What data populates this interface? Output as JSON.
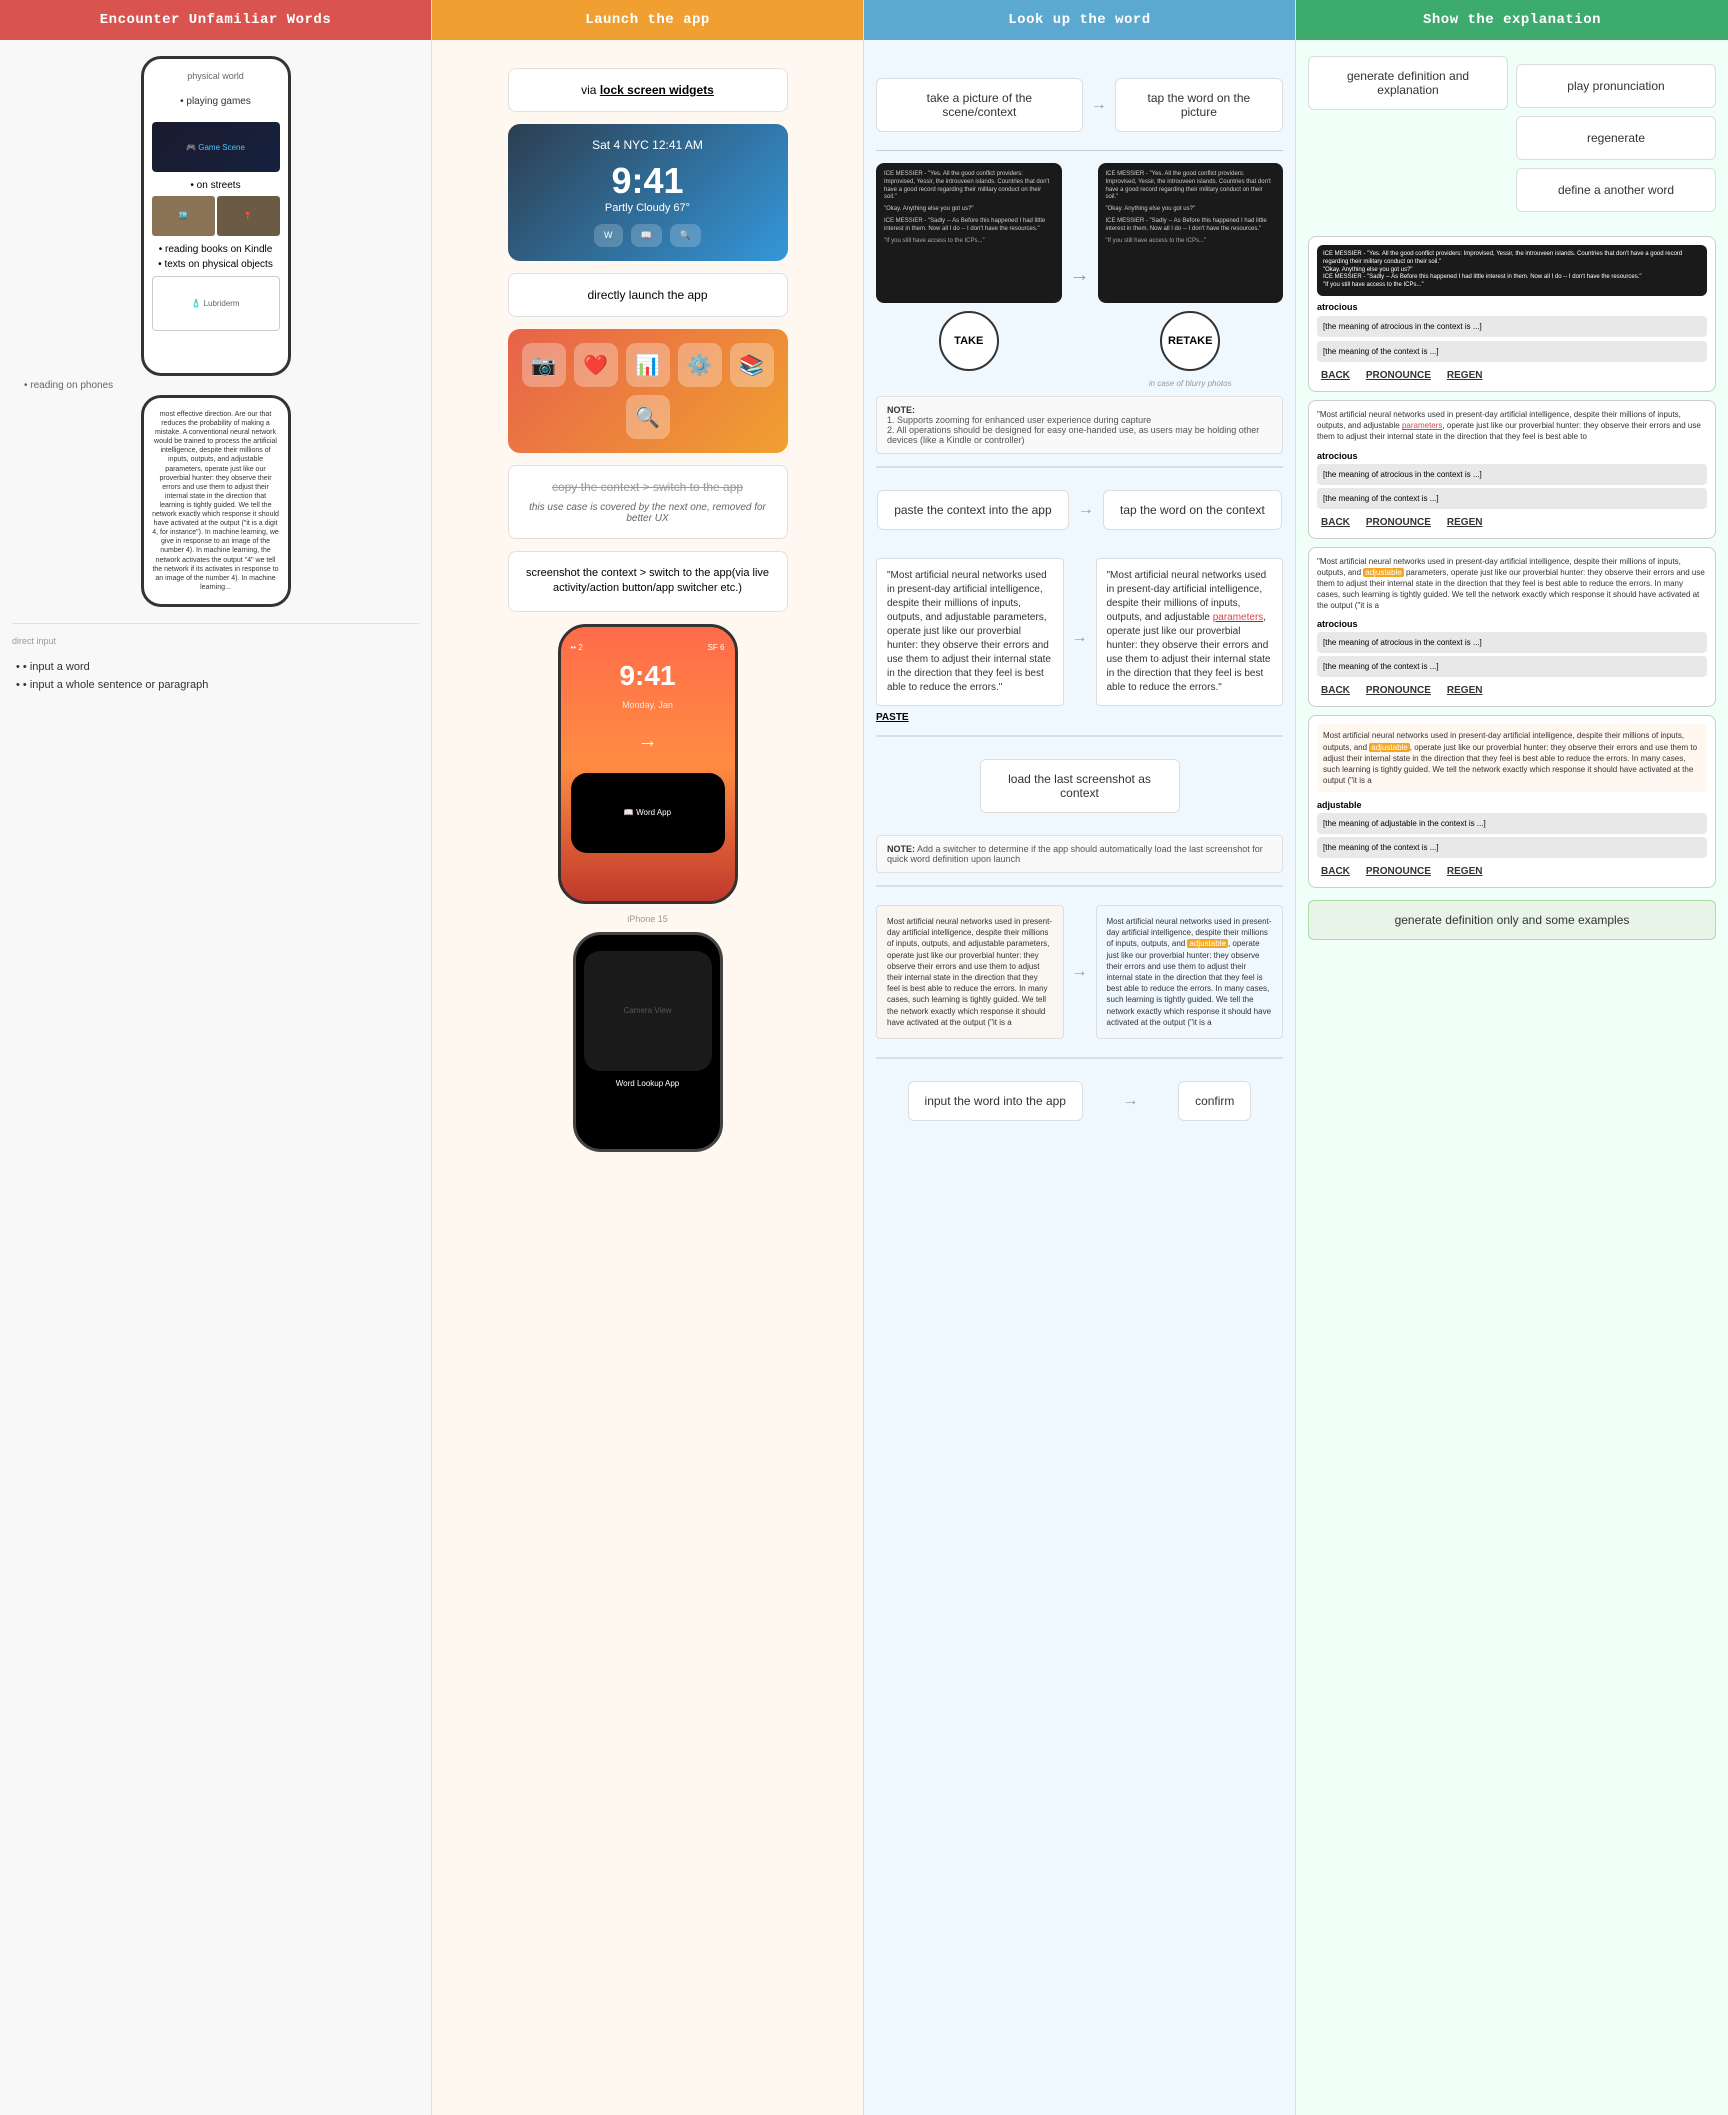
{
  "headers": {
    "col1": "Encounter Unfamiliar Words",
    "col2": "Launch the app",
    "col3": "Look up the word",
    "col4": "Show the explanation"
  },
  "col1": {
    "phone_label": "physical world",
    "bullet1": "playing games",
    "bullet2": "on streets",
    "bullet3": "reading books on Kindle",
    "bullet4": "texts on physical objects",
    "bullet5": "reading on phones",
    "bottom_bullets": {
      "bullet1": "input a word",
      "bullet2": "input a whole sentence or paragraph"
    },
    "bottom_label": "direct input"
  },
  "col2": {
    "widget_text": "via lock screen widgets",
    "lockscreen_date": "Sat 4 NYC 12:41 AM",
    "lockscreen_time": "9:41",
    "lockscreen_weather": "Partly Cloudy",
    "lockscreen_temp": "67",
    "direct_launch": "directly launch the app",
    "copy_switch": "copy the context > switch to the app",
    "italic_note": "this use case is covered by the next one, removed for better UX",
    "screenshot_note": "screenshot the context > switch to the app(via live activity/action button/app switcher etc.)"
  },
  "col3": {
    "take_picture": "take a picture of the scene/context",
    "tap_word": "tap the word on the picture",
    "note_title": "NOTE:",
    "note1": "1. Supports zooming for enhanced user experience during capture",
    "note2": "2. All operations should be designed for easy one-handed use, as users may be holding other devices (like a Kindle or controller)",
    "take_btn": "TAKE",
    "retake_btn": "RETAKE",
    "blurry_note": "in case of blurry photos",
    "paste_context": "paste the context into the app",
    "tap_context": "tap the word on the context",
    "paste_label": "PASTE",
    "passage_text": "\"Most artificial neural networks used in present-day artificial intelligence, despite their millions of inputs, outputs, and adjustable parameters, operate just like our proverbial hunter: they observe their errors and use them to adjust their internal state in the direction that they feel is best able to reduce the errors.\"",
    "load_screenshot": "load the last screenshot as context",
    "note2_title": "NOTE:",
    "note2_text": "Add a switcher to determine if the app should automatically load the last screenshot for quick word definition upon launch",
    "input_word": "input the word into the app",
    "confirm": "confirm"
  },
  "col4": {
    "generate_def": "generate definition and explanation",
    "play_pronunciation": "play pronunciation",
    "regenerate": "regenerate",
    "define_another": "define a another word",
    "word1": "atrocious",
    "word1_def": "[the meaning of atrocious in the context is ...]",
    "word1_context_def": "[the meaning of the context is ...]",
    "back_btn": "BACK",
    "pronounce_btn": "PRONOUNCE",
    "regen_btn": "REGEN",
    "passage_text_full": "\"Most artificial neural networks used in present-day artificial intelligence, despite their millions of inputs, outputs, and adjustable parameters, operate just like our proverbial hunter: they observe their errors and use them to adjust their internal state in the direction that they feel is best able to",
    "word2": "adjustable",
    "word2_def": "[the meaning of adjustable in the context is ...]",
    "word2_context_def": "[the meaning of the context is ...]",
    "generate_def_only": "generate definition only and some examples"
  }
}
